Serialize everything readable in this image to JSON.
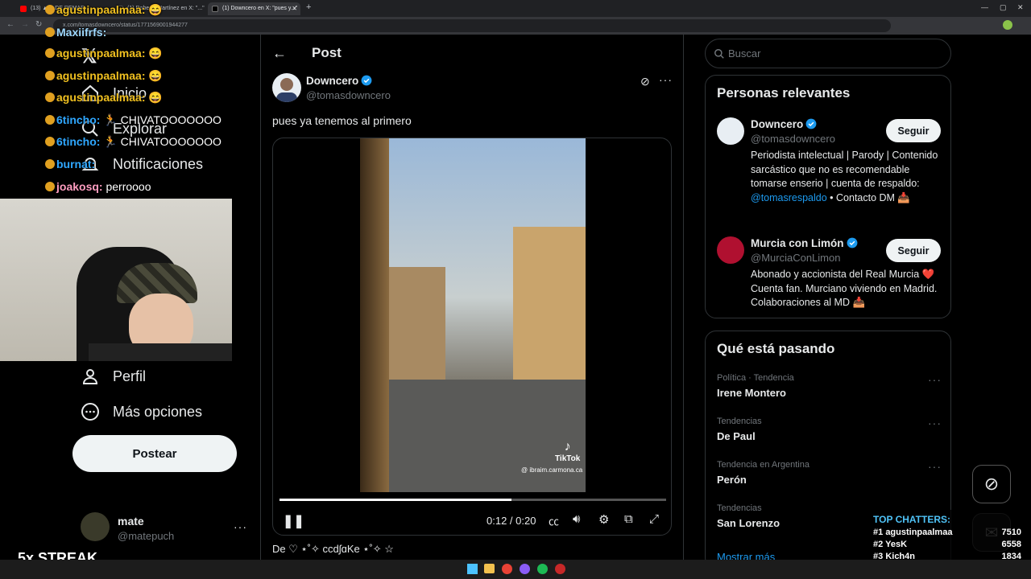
{
  "browser": {
    "tabs": [
      {
        "title": "(13) ▲▲ DE REMAR...",
        "color": "#ff0000"
      },
      {
        "title": "(1) Roberto Martínez en X: \"...\"",
        "color": "#000000"
      },
      {
        "title": "(1) Downcero en X: \"pues y...\"",
        "color": "#000000"
      }
    ],
    "url": "x.com/tomasdowncero/status/1771569001944277"
  },
  "nav": {
    "items": [
      {
        "label": "Inicio",
        "icon": "home-icon"
      },
      {
        "label": "Explorar",
        "icon": "search-icon"
      },
      {
        "label": "Notificaciones",
        "icon": "bell-icon"
      },
      {
        "label": "Perfil",
        "icon": "person-icon"
      },
      {
        "label": "Más opciones",
        "icon": "more-circle-icon"
      }
    ],
    "post_label": "Postear",
    "account": {
      "name": "mate",
      "handle": "@matepuch"
    }
  },
  "post": {
    "header": "Post",
    "author_name": "Downcero",
    "author_handle": "@tomasdowncero",
    "text": "pues ya tenemos al primero",
    "video": {
      "watermark": "TikTok",
      "watermark_user": "@ ibraim.carmona.ca",
      "time": "0:12 / 0:20",
      "progress": 0.6
    },
    "reply_preview": "De ♡ ⋆˚✧ ccdʃɑKe ⋆˚✧ ☆"
  },
  "sidebar": {
    "search_placeholder": "Buscar",
    "relevant_title": "Personas relevantes",
    "people": [
      {
        "name": "Downcero",
        "handle": "@tomasdowncero",
        "follow_label": "Seguir",
        "bio_parts": [
          "Periodista intelectual | Parody | Contenido sarcástico que no es recomendable tomarse enserio | cuenta de respaldo: ",
          "@tomasrespaldo",
          " • Contacto DM 📥"
        ]
      },
      {
        "name": "Murcia con Limón",
        "handle": "@MurciaConLimon",
        "follow_label": "Seguir",
        "bio_parts": [
          "Abonado y accionista del Real Murcia ❤️ Cuenta fan. Murciano viviendo en Madrid. Colaboraciones al MD 📥"
        ]
      }
    ],
    "trends_title": "Qué está pasando",
    "trends": [
      {
        "context": "Política · Tendencia",
        "name": "Irene Montero"
      },
      {
        "context": "Tendencias",
        "name": "De Paul"
      },
      {
        "context": "Tendencia en Argentina",
        "name": "Perón"
      },
      {
        "context": "Tendencias",
        "name": "San Lorenzo"
      }
    ],
    "show_more": "Mostrar más"
  },
  "stream_overlay": {
    "chat": [
      {
        "user": "agustinpaalmaa:",
        "msg": "😄",
        "color": "#f0c020"
      },
      {
        "user": "Maxiifrfs:",
        "msg": "",
        "color": "#9fd9ff"
      },
      {
        "user": "agustinpaalmaa:",
        "msg": "😄",
        "color": "#f0c020"
      },
      {
        "user": "agustinpaalmaa:",
        "msg": "😄",
        "color": "#f0c020"
      },
      {
        "user": "agustinpaalmaa:",
        "msg": "😄",
        "color": "#f0c020"
      },
      {
        "user": "6tincho:",
        "msg": "🏃 CHIVATOOOOOOO",
        "color": "#2fa7ff"
      },
      {
        "user": "6tincho:",
        "msg": "🏃 CHIVATOOOOOOO",
        "color": "#2fa7ff"
      },
      {
        "user": "burnat:",
        "msg": "",
        "color": "#2fa7ff"
      },
      {
        "user": "joakosq:",
        "msg": "perroooo",
        "color": "#ff9dc0"
      }
    ],
    "streak": "5x STREAK",
    "top_chatters_title": "TOP CHATTERS:",
    "top_chatters": [
      {
        "rank": "#1",
        "name": "agustinpaalmaa",
        "count": "7510"
      },
      {
        "rank": "#2",
        "name": "YesK",
        "count": "6558"
      },
      {
        "rank": "#3",
        "name": "Kich4n",
        "count": "1834"
      }
    ]
  }
}
